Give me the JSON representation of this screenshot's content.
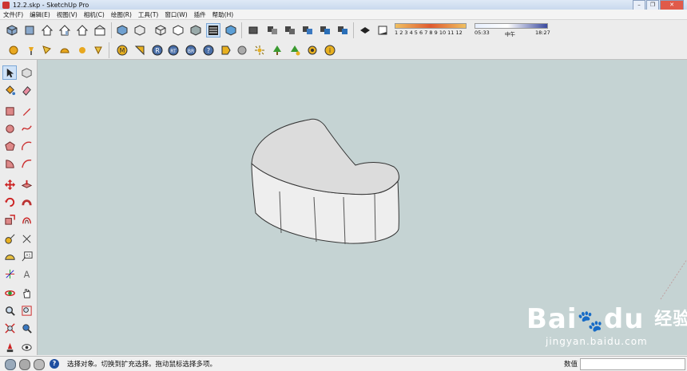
{
  "window": {
    "title": "12.2.skp - SketchUp Pro",
    "buttons": {
      "minimize": "–",
      "maximize": "❐",
      "close": "✕"
    }
  },
  "menu": [
    "文件(F)",
    "编辑(E)",
    "视图(V)",
    "相机(C)",
    "绘图(R)",
    "工具(T)",
    "窗口(W)",
    "插件",
    "帮助(H)"
  ],
  "shadow": {
    "month_ticks": "1 2 3 4 5 6 7 8 9 10 11 12",
    "time_start": "05:33",
    "noon": "中午",
    "time_end": "18:27"
  },
  "status": {
    "hint": "选择对象。切换到扩充选择。拖动鼠标选择多项。",
    "measurements_label": "数值"
  },
  "watermark": {
    "brand_left": "Bai",
    "brand_right": "du",
    "brand_cn": "经验",
    "url": "jingyan.baidu.com"
  },
  "colors": {
    "viewport": "#c5d3d3",
    "model_top": "#dcdcdc",
    "model_side": "#ececec"
  }
}
